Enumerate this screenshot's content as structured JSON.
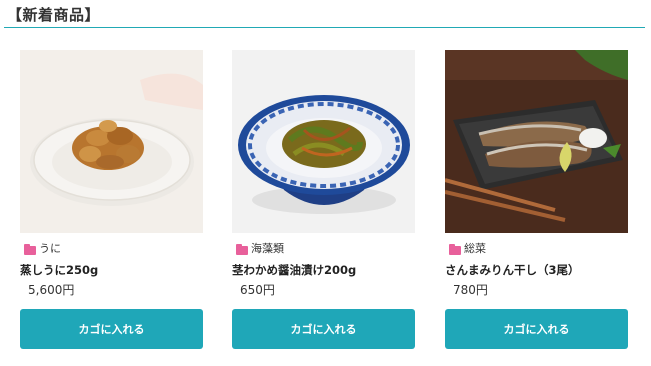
{
  "section": {
    "title": "【新着商品】"
  },
  "colors": {
    "accent": "#1fa7b8",
    "category_icon": "#e8609b"
  },
  "products": [
    {
      "category": "うに",
      "category_icon": "folder-icon",
      "name": "蒸しうに250g",
      "price": "5,600円",
      "button": "カゴに入れる"
    },
    {
      "category": "海藻類",
      "category_icon": "folder-icon",
      "name": "茎わかめ醤油漬け200g",
      "price": "650円",
      "button": "カゴに入れる"
    },
    {
      "category": "総菜",
      "category_icon": "folder-icon",
      "name": "さんまみりん干し（3尾）",
      "price": "780円",
      "button": "カゴに入れる"
    }
  ]
}
